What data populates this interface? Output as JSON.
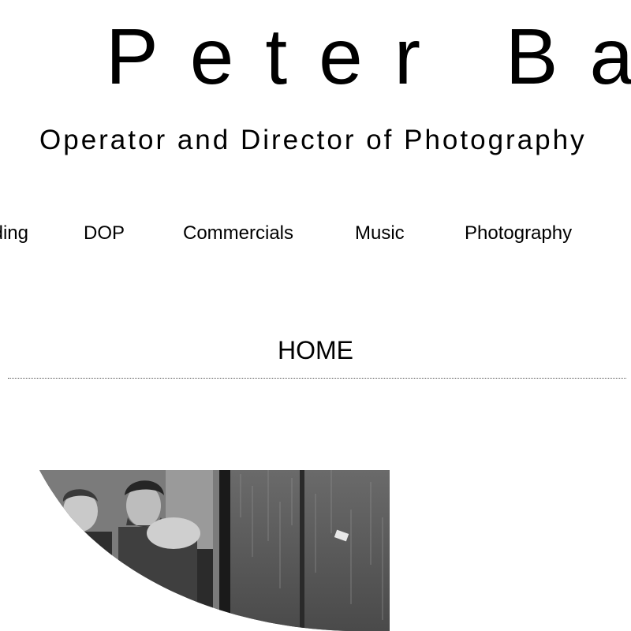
{
  "header": {
    "title": "Peter Bate",
    "tagline": "Operator and Director of Photography"
  },
  "nav": {
    "items": [
      {
        "label": "Grading"
      },
      {
        "label": "DOP"
      },
      {
        "label": "Commercials"
      },
      {
        "label": "Music"
      },
      {
        "label": "Photography"
      }
    ]
  },
  "page": {
    "heading": "HOME"
  },
  "hero": {
    "photo_icon": "black-and-white-photo-of-couple-by-rainy-window"
  }
}
